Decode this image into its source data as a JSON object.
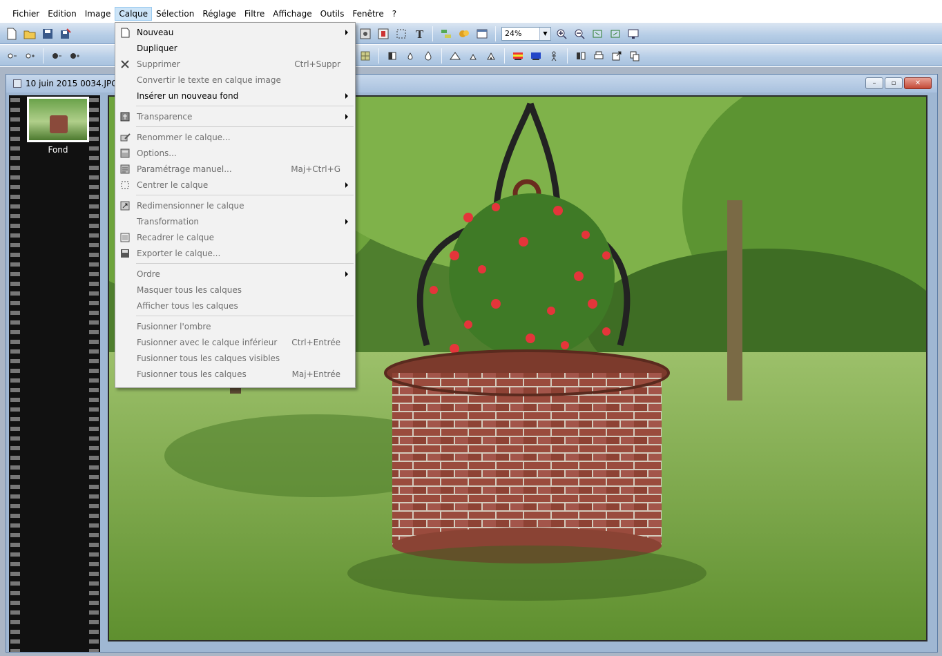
{
  "menubar": {
    "items": [
      "Fichier",
      "Edition",
      "Image",
      "Calque",
      "Sélection",
      "Réglage",
      "Filtre",
      "Affichage",
      "Outils",
      "Fenêtre",
      "?"
    ],
    "active": "Calque"
  },
  "toolbar": {
    "zoom_value": "24%"
  },
  "document": {
    "title": "10 juin 2015 0034.JPG",
    "layer_label": "Fond"
  },
  "layer_menu": {
    "new": "Nouveau",
    "duplicate": "Dupliquer",
    "delete": "Supprimer",
    "delete_shortcut": "Ctrl+Suppr",
    "convert_text": "Convertir le texte en calque image",
    "insert_background": "Insérer un nouveau fond",
    "transparency": "Transparence",
    "rename": "Renommer le calque...",
    "options": "Options...",
    "manual_settings": "Paramétrage manuel...",
    "manual_settings_shortcut": "Maj+Ctrl+G",
    "center": "Centrer le calque",
    "resize": "Redimensionner le calque",
    "transformation": "Transformation",
    "crop": "Recadrer le calque",
    "export": "Exporter le calque...",
    "order": "Ordre",
    "hide_all": "Masquer tous les calques",
    "show_all": "Afficher tous les calques",
    "merge_shadow": "Fusionner l'ombre",
    "merge_down": "Fusionner avec le calque inférieur",
    "merge_down_shortcut": "Ctrl+Entrée",
    "merge_visible": "Fusionner tous les calques visibles",
    "merge_all": "Fusionner tous les calques",
    "merge_all_shortcut": "Maj+Entrée"
  },
  "colors": {
    "menu_bg": "#f2f2f2",
    "toolbar": "#b6cde6",
    "filmstrip": "#111111"
  }
}
